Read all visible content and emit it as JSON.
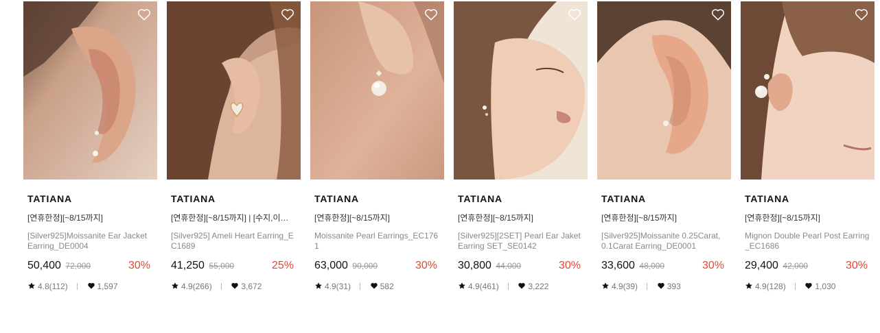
{
  "products": [
    {
      "brand": "TATIANA",
      "promo": "[연휴한정][~8/15까지]",
      "title": "[Silver925]Moissanite Ear Jacket Earring_DE0004",
      "price": "50,400",
      "original_price": "72,000",
      "discount": "30%",
      "rating": "4.8(112)",
      "likes": "1,597",
      "wishlist_icon": "heart-outline-icon",
      "image": "close-up of an ear with a moissanite ear jacket earring"
    },
    {
      "brand": "TATIANA",
      "promo": "[연휴한정][~8/15까지] | [수지,이…",
      "title": "[Silver925] Ameli Heart Earring_EC1689",
      "price": "41,250",
      "original_price": "55,000",
      "discount": "25%",
      "rating": "4.9(266)",
      "likes": "3,672",
      "wishlist_icon": "heart-outline-icon",
      "image": "ear with a pearl heart earring framed by brown hair"
    },
    {
      "brand": "TATIANA",
      "promo": "[연휴한정][~8/15까지]",
      "title": "Moissanite Pearl Earrings_EC1761",
      "price": "63,000",
      "original_price": "90,000",
      "discount": "30%",
      "rating": "4.9(31)",
      "likes": "582",
      "wishlist_icon": "heart-outline-icon",
      "image": "ear with a moissanite and pearl drop earring"
    },
    {
      "brand": "TATIANA",
      "promo": "[연휴한정][~8/15까지]",
      "title": "[Silver925][2SET] Pearl Ear Jaket Earring SET_SE0142",
      "price": "30,800",
      "original_price": "44,000",
      "discount": "30%",
      "rating": "4.9(461)",
      "likes": "3,222",
      "wishlist_icon": "heart-outline-icon",
      "image": "profile of a woman wearing a pearl ear jacket earring set"
    },
    {
      "brand": "TATIANA",
      "promo": "[연휴한정][~8/15까지]",
      "title": "[Silver925]Moissanite 0.25Carat, 0.1Carat Earring_DE0001",
      "price": "33,600",
      "original_price": "48,000",
      "discount": "30%",
      "rating": "4.9(39)",
      "likes": "393",
      "wishlist_icon": "heart-outline-icon",
      "image": "ear with a small moissanite stud earring"
    },
    {
      "brand": "TATIANA",
      "promo": "[연휴한정][~8/15까지]",
      "title": "Mignon Double Pearl Post Earring_EC1686",
      "price": "29,400",
      "original_price": "42,000",
      "discount": "30%",
      "rating": "4.9(128)",
      "likes": "1,030",
      "wishlist_icon": "heart-outline-icon",
      "image": "close-up of a face wearing a double pearl post earring"
    }
  ],
  "colors": {
    "discount": "#e8472d",
    "brand_text": "#111111",
    "muted_text": "#888888"
  }
}
